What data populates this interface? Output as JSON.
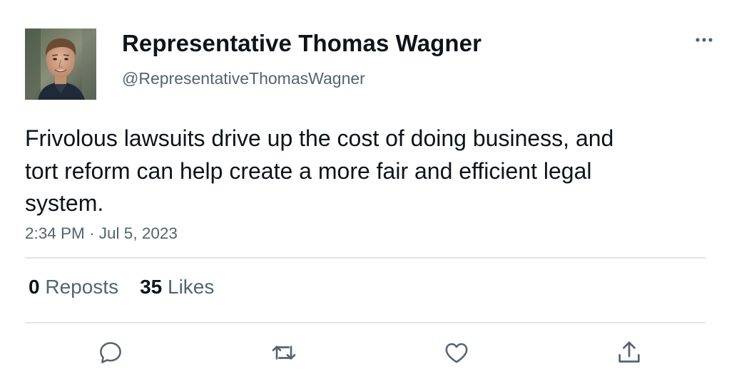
{
  "author": {
    "display_name": "Representative Thomas Wagner",
    "handle": "@RepresentativeThomasWagner",
    "avatar_icon": "profile-photo-man"
  },
  "more_icon": "more-horizontal-icon",
  "tweet": {
    "text": "Frivolous lawsuits drive up the cost of doing business, and tort reform can help create a more fair and efficient legal system.",
    "timestamp": "2:34 PM · Jul 5, 2023"
  },
  "stats": {
    "reposts_count": "0",
    "reposts_label": "Reposts",
    "likes_count": "35",
    "likes_label": "Likes"
  },
  "actions": [
    {
      "name": "reply",
      "icon": "reply-icon"
    },
    {
      "name": "repost",
      "icon": "repost-icon"
    },
    {
      "name": "like",
      "icon": "heart-icon"
    },
    {
      "name": "share",
      "icon": "share-icon"
    }
  ],
  "colors": {
    "text_primary": "#0f1419",
    "text_secondary": "#536471",
    "divider": "#e1e5e8"
  }
}
